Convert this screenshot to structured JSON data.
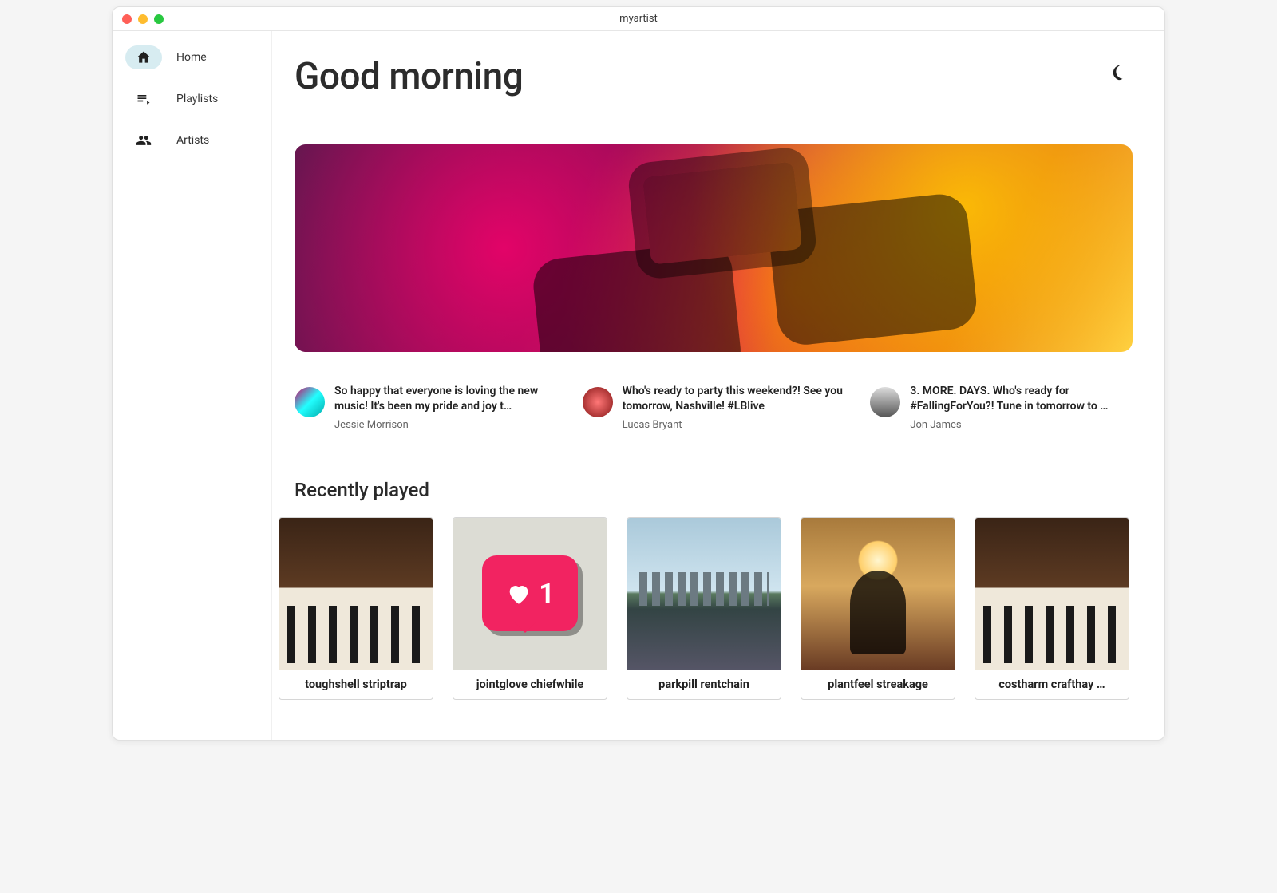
{
  "window": {
    "title": "myartist"
  },
  "sidebar": {
    "items": [
      {
        "label": "Home",
        "icon": "home-icon",
        "active": true
      },
      {
        "label": "Playlists",
        "icon": "playlist-icon",
        "active": false
      },
      {
        "label": "Artists",
        "icon": "artists-icon",
        "active": false
      }
    ]
  },
  "header": {
    "greeting": "Good morning",
    "theme_toggle_icon": "moon-icon"
  },
  "hero": {
    "image_desc": "concert-crowd-phone-hero"
  },
  "updates": [
    {
      "message": "So happy that everyone is loving the new music! It's been my pride and joy t…",
      "author": "Jessie Morrison",
      "avatar": "av1"
    },
    {
      "message": "Who's ready to party this weekend?! See you tomorrow, Nashville! #LBlive",
      "author": "Lucas Bryant",
      "avatar": "av2"
    },
    {
      "message": "3. MORE. DAYS. Who's ready for #FallingForYou?! Tune in tomorrow to …",
      "author": "Jon James",
      "avatar": "av3"
    }
  ],
  "recently_played": {
    "title": "Recently played",
    "items": [
      {
        "label": "toughshell striptrap",
        "thumb": "t-piano"
      },
      {
        "label": "jointglove chiefwhile",
        "thumb": "t-like"
      },
      {
        "label": "parkpill rentchain",
        "thumb": "t-city"
      },
      {
        "label": "plantfeel streakage",
        "thumb": "t-yoga"
      },
      {
        "label": "costharm crafthay …",
        "thumb": "t-piano"
      }
    ]
  }
}
